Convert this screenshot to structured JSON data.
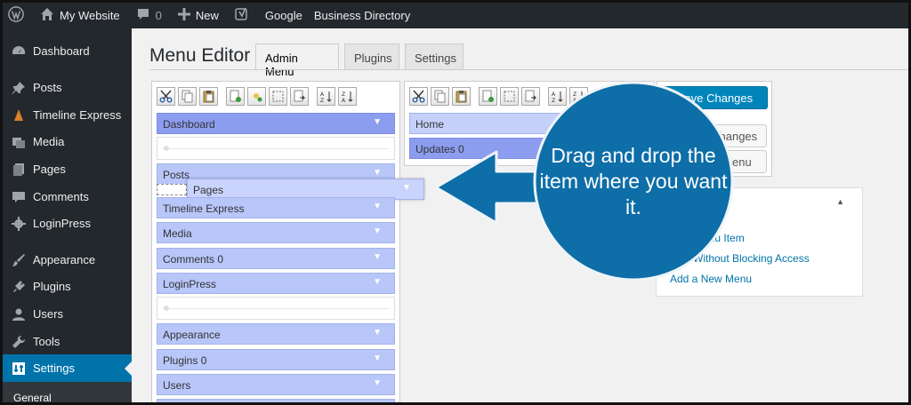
{
  "admin_bar": {
    "site_name": "My Website",
    "comments_count": "0",
    "new_label": "New",
    "google_label": "Google",
    "business_directory_label": "Business Directory"
  },
  "sidebar": {
    "items": [
      {
        "label": "Dashboard",
        "icon": "dashboard-icon"
      },
      {
        "label": "Posts",
        "icon": "pin-icon"
      },
      {
        "label": "Timeline Express",
        "icon": "cone-icon"
      },
      {
        "label": "Media",
        "icon": "media-icon"
      },
      {
        "label": "Pages",
        "icon": "pages-icon"
      },
      {
        "label": "Comments",
        "icon": "comment-icon"
      },
      {
        "label": "LoginPress",
        "icon": "gear-icon"
      },
      {
        "label": "Appearance",
        "icon": "brush-icon"
      },
      {
        "label": "Plugins",
        "icon": "plug-icon"
      },
      {
        "label": "Users",
        "icon": "user-icon"
      },
      {
        "label": "Tools",
        "icon": "wrench-icon"
      },
      {
        "label": "Settings",
        "icon": "settings-icon"
      }
    ],
    "submenu_first": "General",
    "active_color": "#0073aa"
  },
  "page": {
    "title": "Menu Editor",
    "tabs": [
      "Admin Menu",
      "Plugins",
      "Settings"
    ]
  },
  "left_menu": {
    "items": [
      "Dashboard",
      "Posts",
      "Timeline Express",
      "Media",
      "Comments 0",
      "LoginPress",
      "Appearance",
      "Plugins 0",
      "Users"
    ],
    "dragging_item": "Pages"
  },
  "right_menu": {
    "items": [
      "Home",
      "Updates 0"
    ]
  },
  "actions": {
    "save_changes": "Save Changes",
    "undo_changes": "changes",
    "load_default": "t menu"
  },
  "howto": {
    "links": [
      "enu Item",
      "Without Blocking Access",
      "Add a New Menu"
    ]
  },
  "callout": {
    "text": "Drag and drop the item where you want it.",
    "color": "#0e6ea8"
  }
}
